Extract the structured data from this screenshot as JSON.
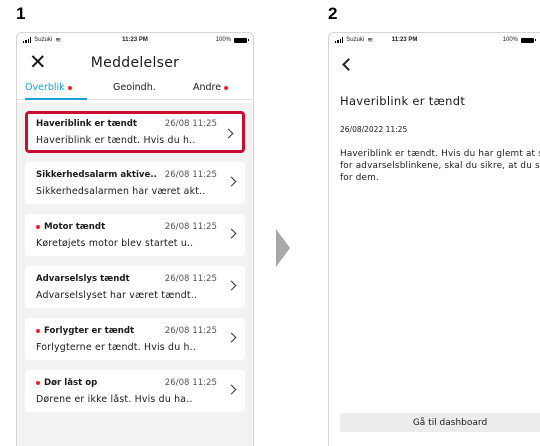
{
  "steps": [
    "1",
    "2"
  ],
  "status_bar": {
    "carrier": "Suzuki",
    "time": "11:23 PM",
    "battery": "100%"
  },
  "overview": {
    "title": "Meddelelser",
    "tabs": [
      {
        "label": "Overblik",
        "active": true,
        "dot": true
      },
      {
        "label": "Geoindh.",
        "active": false,
        "dot": false
      },
      {
        "label": "Andre",
        "active": false,
        "dot": true
      }
    ],
    "messages": [
      {
        "title": "Haveriblink er tændt",
        "date": "26/08 11:25",
        "preview": "Haveriblink er tændt. Hvis du h..",
        "unread": false,
        "highlighted": true
      },
      {
        "title": "Sikkerhedsalarm aktive..",
        "date": "26/08 11:25",
        "preview": "Sikkerhedsalarmen har været akt..",
        "unread": false,
        "highlighted": false
      },
      {
        "title": "Motor tændt",
        "date": "26/08 11:25",
        "preview": "Køretøjets motor blev startet u..",
        "unread": true,
        "highlighted": false
      },
      {
        "title": "Advarselslys tændt",
        "date": "26/08 11:25",
        "preview": "Advarselslyset har været tændt..",
        "unread": false,
        "highlighted": false
      },
      {
        "title": "Forlygter er tændt",
        "date": "26/08 11:25",
        "preview": "Forlygterne er tændt. Hvis du h..",
        "unread": true,
        "highlighted": false
      },
      {
        "title": "Dør låst op",
        "date": "26/08 11:25",
        "preview": "Dørene er ikke låst. Hvis du ha..",
        "unread": true,
        "highlighted": false
      }
    ]
  },
  "detail": {
    "title": "Haveriblink er tændt",
    "date": "26/08/2022 11:25",
    "body": "Haveriblink er tændt. Hvis du har glemt at slukke for advarselsblinkene, skal du sikre, at du slukker for dem.",
    "button_label": "Gå til dashboard"
  },
  "colors": {
    "accent": "#1e9fd6",
    "unread_dot": "#e8272d",
    "highlight_border": "#c8102e",
    "list_background": "#f2f2f2"
  },
  "icons": [
    "close-icon",
    "chevron-right-icon",
    "arrow-right-icon",
    "back-icon",
    "signal-icon",
    "wifi-icon",
    "battery-icon"
  ]
}
